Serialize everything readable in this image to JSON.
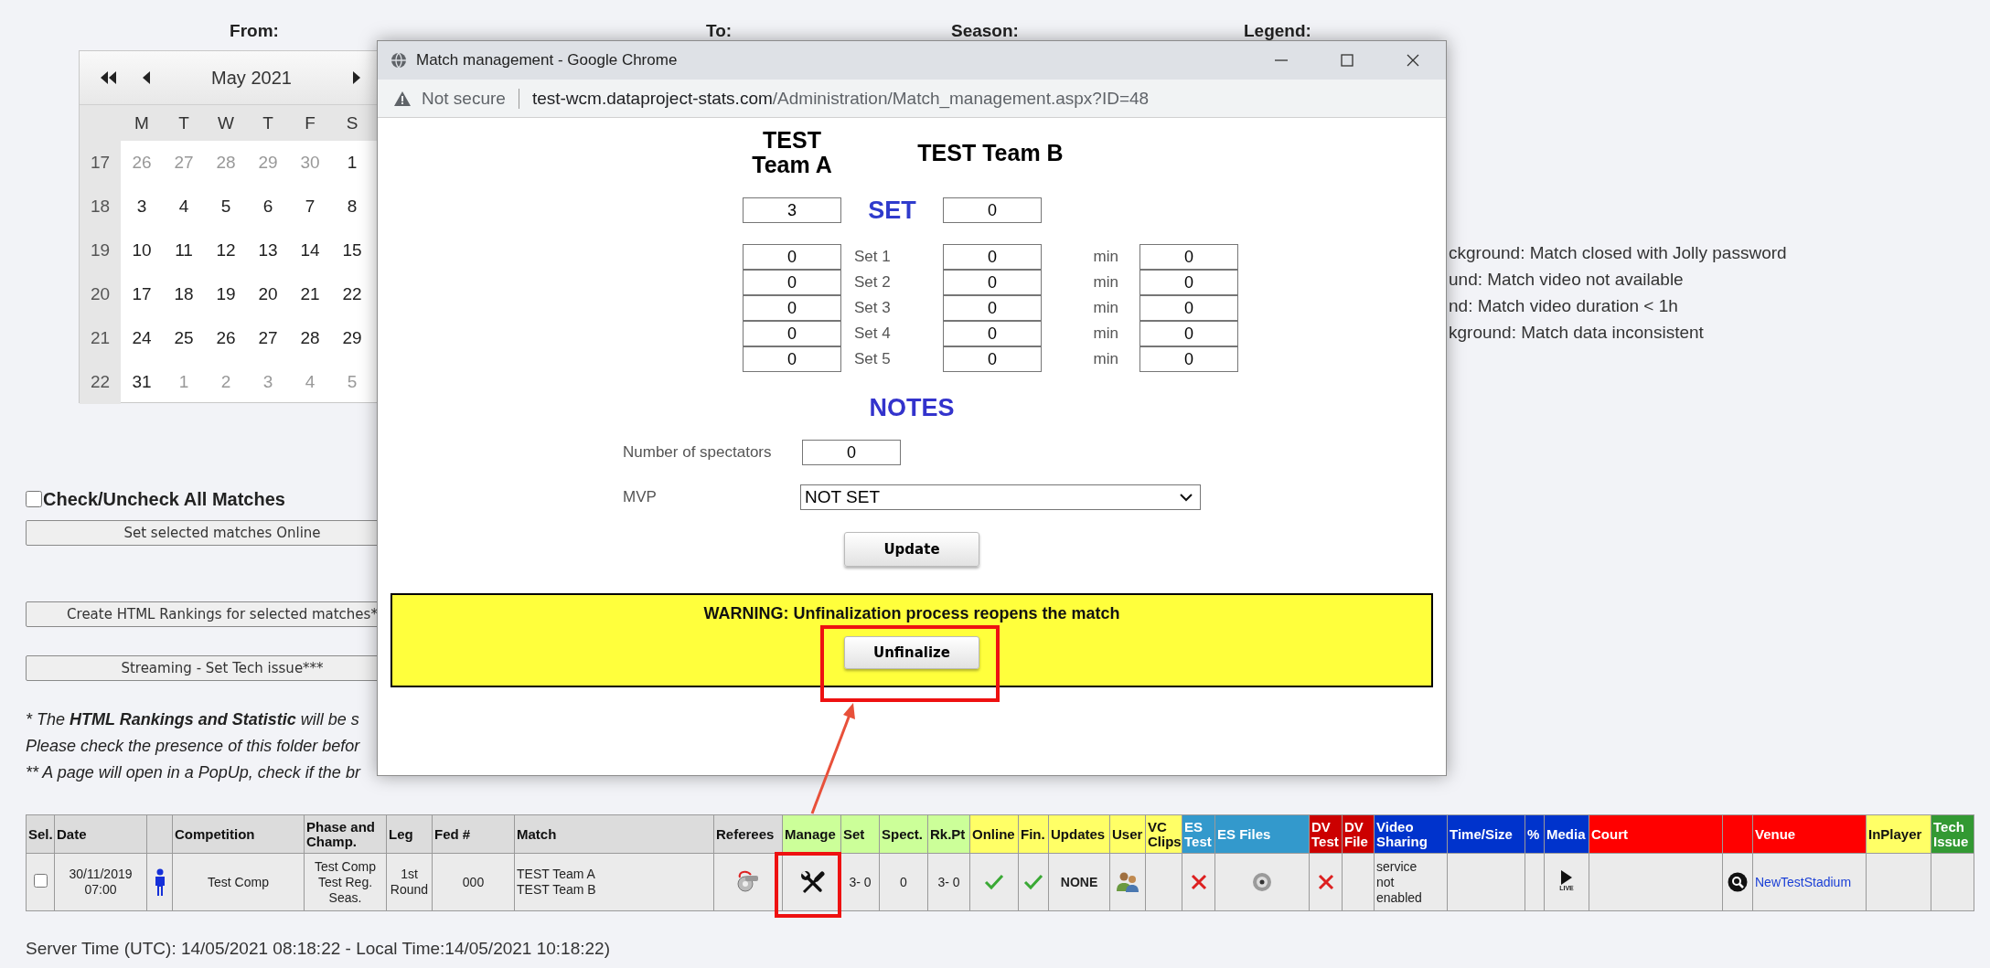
{
  "filters": {
    "from_label": "From:",
    "to_label": "To:",
    "season_label": "Season:",
    "legend_label": "Legend:"
  },
  "calendar": {
    "month": "May 2021",
    "weekdays": [
      "M",
      "T",
      "W",
      "T",
      "F",
      "S"
    ],
    "weeks": [
      {
        "week": "17",
        "days": [
          {
            "day": "26",
            "other_month": true
          },
          {
            "day": "27",
            "other_month": true
          },
          {
            "day": "28",
            "other_month": true
          },
          {
            "day": "29",
            "other_month": true
          },
          {
            "day": "30",
            "other_month": true
          },
          {
            "day": "1",
            "other_month": false
          }
        ]
      },
      {
        "week": "18",
        "days": [
          {
            "day": "3",
            "other_month": false
          },
          {
            "day": "4",
            "other_month": false
          },
          {
            "day": "5",
            "other_month": false
          },
          {
            "day": "6",
            "other_month": false
          },
          {
            "day": "7",
            "other_month": false
          },
          {
            "day": "8",
            "other_month": false
          }
        ]
      },
      {
        "week": "19",
        "days": [
          {
            "day": "10",
            "other_month": false
          },
          {
            "day": "11",
            "other_month": false
          },
          {
            "day": "12",
            "other_month": false
          },
          {
            "day": "13",
            "other_month": false
          },
          {
            "day": "14",
            "other_month": false
          },
          {
            "day": "15",
            "other_month": false
          }
        ]
      },
      {
        "week": "20",
        "days": [
          {
            "day": "17",
            "other_month": false
          },
          {
            "day": "18",
            "other_month": false
          },
          {
            "day": "19",
            "other_month": false
          },
          {
            "day": "20",
            "other_month": false
          },
          {
            "day": "21",
            "other_month": false
          },
          {
            "day": "22",
            "other_month": false
          }
        ]
      },
      {
        "week": "21",
        "days": [
          {
            "day": "24",
            "other_month": false
          },
          {
            "day": "25",
            "other_month": false
          },
          {
            "day": "26",
            "other_month": false
          },
          {
            "day": "27",
            "other_month": false
          },
          {
            "day": "28",
            "other_month": false
          },
          {
            "day": "29",
            "other_month": false
          }
        ]
      },
      {
        "week": "22",
        "days": [
          {
            "day": "31",
            "other_month": false
          },
          {
            "day": "1",
            "other_month": true
          },
          {
            "day": "2",
            "other_month": true
          },
          {
            "day": "3",
            "other_month": true
          },
          {
            "day": "4",
            "other_month": true
          },
          {
            "day": "5",
            "other_month": true
          }
        ]
      }
    ]
  },
  "legend": [
    "ckground: Match closed with Jolly password",
    "und: Match video not available",
    "nd: Match video duration < 1h",
    "kground: Match data inconsistent"
  ],
  "select_all": {
    "label": "Check/Uncheck All Matches",
    "checked": false
  },
  "actions": [
    "Set selected matches Online",
    "Create HTML Rankings for selected matches*",
    "Streaming - Set Tech issue***"
  ],
  "notes": [
    "* The **HTML Rankings and Statistic** will be s",
    "Please check the presence of this folder befor",
    "** A page will open in a PopUp, check if the br"
  ],
  "table": {
    "columns": [
      {
        "label": "Sel.",
        "color": "#dcdcdc"
      },
      {
        "label": "Date",
        "color": "#dcdcdc"
      },
      {
        "color": "#dcdcdc"
      },
      {
        "label": "Competition",
        "color": "#dcdcdc"
      },
      {
        "label": "Phase and Champ.",
        "color": "#dcdcdc"
      },
      {
        "label": "Leg",
        "color": "#dcdcdc"
      },
      {
        "label": "Fed #",
        "color": "#dcdcdc"
      },
      {
        "label": "Match",
        "color": "#dcdcdc"
      },
      {
        "label": "Referees",
        "color": "#dcdcdc"
      },
      {
        "label": "Manage",
        "color": "#ccff99"
      },
      {
        "label": "Set",
        "color": "#ccff99"
      },
      {
        "label": "Spect.",
        "color": "#ccff99"
      },
      {
        "label": "Rk.Pt",
        "color": "#ccff99"
      },
      {
        "label": "Online",
        "color": "#ffff66"
      },
      {
        "label": "Fin.",
        "color": "#ffff66"
      },
      {
        "label": "Updates",
        "color": "#ffff66"
      },
      {
        "label": "User",
        "color": "#ffff66"
      },
      {
        "label": "VC Clips",
        "color": "#ffff66"
      },
      {
        "label": "ES Test",
        "color": "#3399cc"
      },
      {
        "label": "ES Files",
        "color": "#3399cc"
      },
      {
        "label": "DV Test",
        "color": "#cc0000"
      },
      {
        "label": "DV File",
        "color": "#cc0000"
      },
      {
        "label": "Video Sharing",
        "color": "#0033cc"
      },
      {
        "label": "Time/Size",
        "color": "#0033cc"
      },
      {
        "label": "%",
        "color": "#0033cc"
      },
      {
        "label": "Media",
        "color": "#0033cc"
      },
      {
        "label": "Court",
        "color": "#ff0000"
      },
      {
        "color": "#ff0000"
      },
      {
        "label": "Venue",
        "color": "#ff0000"
      },
      {
        "label": "InPlayer",
        "color": "#ffff66"
      },
      {
        "label": "Tech Issue",
        "color": "#339933"
      }
    ],
    "rows": [
      {
        "cells": [
          {
            "kind": "checkbox",
            "checked": false
          },
          {
            "kind": "text",
            "text": "30/11/2019\n07:00"
          },
          {
            "kind": "person"
          },
          {
            "kind": "text",
            "text": "Test Comp"
          },
          {
            "kind": "text",
            "text": "Test Comp\nTest Reg.\nSeas."
          },
          {
            "kind": "text",
            "text": "1st\nRound"
          },
          {
            "kind": "text",
            "text": "000"
          },
          {
            "kind": "text",
            "text": "TEST Team A\nTEST Team B"
          },
          {
            "kind": "referee"
          },
          {
            "kind": "tools"
          },
          {
            "kind": "text",
            "text": "3- 0"
          },
          {
            "kind": "text",
            "text": "0"
          },
          {
            "kind": "text",
            "text": "3- 0"
          },
          {
            "kind": "check"
          },
          {
            "kind": "check"
          },
          {
            "kind": "bold",
            "text": "NONE"
          },
          {
            "kind": "users"
          },
          {
            "kind": "empty"
          },
          {
            "kind": "cross"
          },
          {
            "kind": "disc"
          },
          {
            "kind": "cross"
          },
          {
            "kind": "empty"
          },
          {
            "kind": "text",
            "text": "service\nnot\nenabled"
          },
          {
            "kind": "empty"
          },
          {
            "kind": "empty"
          },
          {
            "kind": "play",
            "text": "LIVE"
          },
          {
            "kind": "empty"
          },
          {
            "kind": "search"
          },
          {
            "kind": "link",
            "text": "NewTestStadium"
          },
          {
            "kind": "empty"
          },
          {
            "kind": "empty"
          }
        ]
      }
    ]
  },
  "server_time": "Server Time (UTC): 14/05/2021 08:18:22 - Local Time:14/05/2021 10:18:22)",
  "popup": {
    "title": "Match management - Google Chrome",
    "security": "Not secure",
    "url_host": "test-wcm.dataproject-stats.com",
    "url_path": "/Administration/Match_management.aspx?ID=48",
    "team_a": "TEST Team A",
    "team_b": "TEST Team B",
    "set_label": "SET",
    "sets_a": "3",
    "sets_b": "0",
    "set_rows": [
      {
        "label": "Set 1",
        "a": "0",
        "b": "0",
        "min_label": "min",
        "minutes": "0"
      },
      {
        "label": "Set 2",
        "a": "0",
        "b": "0",
        "min_label": "min",
        "minutes": "0"
      },
      {
        "label": "Set 3",
        "a": "0",
        "b": "0",
        "min_label": "min",
        "minutes": "0"
      },
      {
        "label": "Set 4",
        "a": "0",
        "b": "0",
        "min_label": "min",
        "minutes": "0"
      },
      {
        "label": "Set 5",
        "a": "0",
        "b": "0",
        "min_label": "min",
        "minutes": "0"
      }
    ],
    "notes_heading": "NOTES",
    "spectators_label": "Number of spectators",
    "spectators": "0",
    "mvp_label": "MVP",
    "mvp": "NOT SET",
    "update": "Update",
    "warning": "WARNING: Unfinalization process reopens the match",
    "unfinalize": "Unfinalize"
  }
}
